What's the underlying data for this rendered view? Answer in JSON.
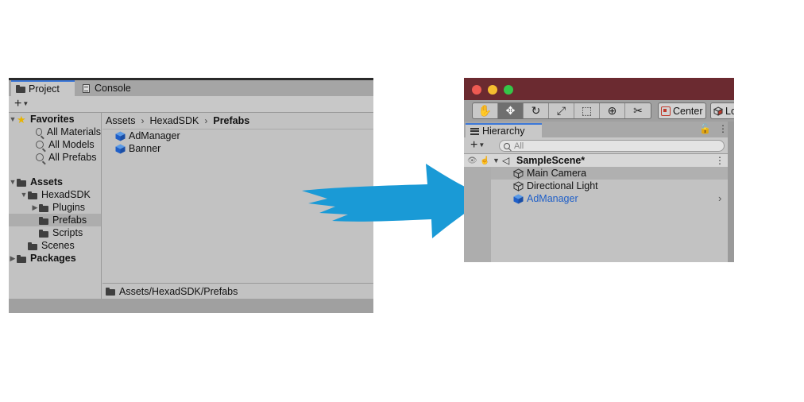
{
  "project": {
    "tabs": [
      {
        "label": "Project",
        "icon": "folder-icon",
        "active": true
      },
      {
        "label": "Console",
        "icon": "console-icon",
        "active": false
      }
    ],
    "toolbar": {
      "add_label": "+"
    },
    "favorites": {
      "label": "Favorites",
      "items": [
        "All Materials",
        "All Models",
        "All Prefabs"
      ]
    },
    "tree": {
      "assets": "Assets",
      "hexad": "HexadSDK",
      "plugins": "Plugins",
      "prefabs": "Prefabs",
      "scripts": "Scripts",
      "scenes": "Scenes",
      "packages": "Packages"
    },
    "breadcrumb": [
      "Assets",
      "HexadSDK",
      "Prefabs"
    ],
    "assets": [
      "AdManager",
      "Banner"
    ],
    "path": "Assets/HexadSDK/Prefabs"
  },
  "hierarchy": {
    "tab_label": "Hierarchy",
    "search_placeholder": "All",
    "pivot_center": "Center",
    "pivot_local": "Lo",
    "scene_name": "SampleScene*",
    "objects": [
      {
        "label": "Main Camera",
        "icon": "gameobject-icon"
      },
      {
        "label": "Directional Light",
        "icon": "gameobject-icon"
      },
      {
        "label": "AdManager",
        "icon": "prefab-icon"
      }
    ],
    "tool_icons": [
      "hand-icon",
      "move-icon",
      "rotate-icon",
      "scale-icon",
      "rect-icon",
      "transform-icon",
      "custom-tool-icon"
    ]
  },
  "colors": {
    "arrow": "#1a9ad6",
    "titlebar": "#6b2a30",
    "prefab_blue": "#1f5fc8",
    "selection": "#adadad"
  }
}
